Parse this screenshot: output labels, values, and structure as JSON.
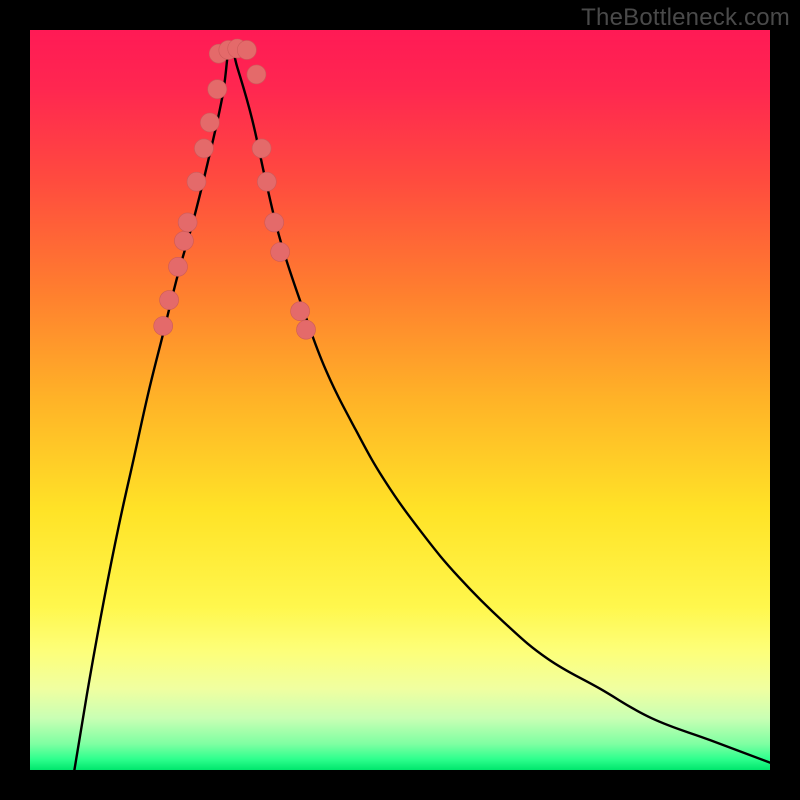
{
  "watermark": "TheBottleneck.com",
  "colors": {
    "frame": "#000000",
    "gradient_stops": [
      {
        "offset": 0.0,
        "color": "#ff1a55"
      },
      {
        "offset": 0.08,
        "color": "#ff2750"
      },
      {
        "offset": 0.2,
        "color": "#ff4a3f"
      },
      {
        "offset": 0.35,
        "color": "#ff7d2f"
      },
      {
        "offset": 0.5,
        "color": "#ffb327"
      },
      {
        "offset": 0.65,
        "color": "#ffe327"
      },
      {
        "offset": 0.78,
        "color": "#fff74d"
      },
      {
        "offset": 0.84,
        "color": "#fdff7a"
      },
      {
        "offset": 0.89,
        "color": "#f0ffa0"
      },
      {
        "offset": 0.93,
        "color": "#c9ffb4"
      },
      {
        "offset": 0.965,
        "color": "#7effa2"
      },
      {
        "offset": 0.985,
        "color": "#2fff8e"
      },
      {
        "offset": 1.0,
        "color": "#00e66c"
      }
    ],
    "curve": "#000000",
    "bead_fill": "#e46a6a",
    "bead_stroke": "#cc5a5a"
  },
  "chart_data": {
    "type": "line",
    "title": "",
    "xlabel": "",
    "ylabel": "",
    "xlim": [
      0,
      100
    ],
    "ylim": [
      0,
      100
    ],
    "note": "V-shaped bottleneck curve; minimum near x≈27. Values are read approximately from pixel positions (0 at top of plot, 100 at bottom/green).",
    "series": [
      {
        "name": "bottleneck-curve",
        "x": [
          6,
          8,
          10,
          12,
          14,
          16,
          18,
          20,
          22,
          24,
          26,
          27,
          28,
          30,
          32,
          34,
          37,
          40,
          44,
          48,
          53,
          58,
          64,
          70,
          77,
          84,
          92,
          100
        ],
        "y": [
          0,
          12,
          23,
          33,
          42,
          51,
          59,
          67,
          74,
          82,
          91,
          98,
          95,
          88,
          79,
          71,
          62,
          54,
          46,
          39,
          32,
          26,
          20,
          15,
          11,
          7,
          4,
          1
        ]
      }
    ],
    "beads": {
      "name": "sample-points",
      "note": "Salmon dot markers along the curve, clustered near the minimum and lower flanks.",
      "points": [
        {
          "x": 18.0,
          "y": 60.0
        },
        {
          "x": 18.8,
          "y": 63.5
        },
        {
          "x": 20.0,
          "y": 68.0
        },
        {
          "x": 20.8,
          "y": 71.5
        },
        {
          "x": 21.3,
          "y": 74.0
        },
        {
          "x": 22.5,
          "y": 79.5
        },
        {
          "x": 23.5,
          "y": 84.0
        },
        {
          "x": 24.3,
          "y": 87.5
        },
        {
          "x": 25.3,
          "y": 92.0
        },
        {
          "x": 25.5,
          "y": 96.8
        },
        {
          "x": 26.8,
          "y": 97.3
        },
        {
          "x": 28.0,
          "y": 97.5
        },
        {
          "x": 29.3,
          "y": 97.3
        },
        {
          "x": 30.6,
          "y": 94.0
        },
        {
          "x": 31.3,
          "y": 84.0
        },
        {
          "x": 32.0,
          "y": 79.5
        },
        {
          "x": 33.0,
          "y": 74.0
        },
        {
          "x": 33.8,
          "y": 70.0
        },
        {
          "x": 36.5,
          "y": 62.0
        },
        {
          "x": 37.3,
          "y": 59.5
        }
      ]
    }
  }
}
